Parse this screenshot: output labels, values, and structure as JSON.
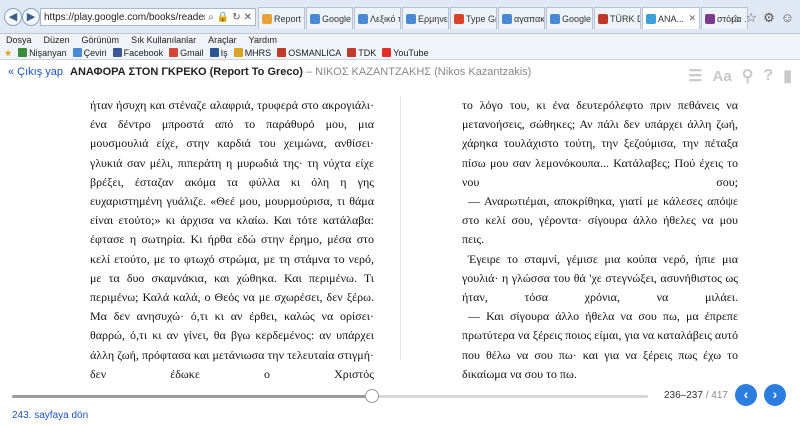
{
  "browser": {
    "url": "https://play.google.com/books/reader?printsec=fr",
    "tabs": [
      {
        "label": "Report t...",
        "color": "#e8a23a"
      },
      {
        "label": "Google ...",
        "color": "#4a8ad4"
      },
      {
        "label": "Λεξικό τ...",
        "color": "#4a8ad4"
      },
      {
        "label": "Ερμηνευ...",
        "color": "#4a8ad4"
      },
      {
        "label": "Type Gr...",
        "color": "#d9442b"
      },
      {
        "label": "αγαπακ...",
        "color": "#4a8ad4"
      },
      {
        "label": "Google ...",
        "color": "#4a8ad4"
      },
      {
        "label": "TÜRK Dİ...",
        "color": "#c0392b"
      },
      {
        "label": "ΑΝΑ...",
        "color": "#3aa0d8",
        "active": true
      },
      {
        "label": "στόμα ...",
        "color": "#7a3b8f"
      }
    ]
  },
  "menu": [
    "Dosya",
    "Düzen",
    "Görünüm",
    "Sık Kullanılanlar",
    "Araçlar",
    "Yardım"
  ],
  "favorites": [
    {
      "label": "Nişanyan",
      "color": "#3c8b3c"
    },
    {
      "label": "Çeviri",
      "color": "#4a8ad4"
    },
    {
      "label": "Facebook",
      "color": "#3b5998"
    },
    {
      "label": "Gmail",
      "color": "#d44638"
    },
    {
      "label": "Iş",
      "color": "#2b5797"
    },
    {
      "label": "MHRS",
      "color": "#d9a520"
    },
    {
      "label": "OSMANLICA",
      "color": "#c0392b"
    },
    {
      "label": "TDK",
      "color": "#c0392b"
    },
    {
      "label": "YouTube",
      "color": "#e52d27"
    }
  ],
  "book": {
    "back_label": "« Çıkış yap",
    "title": "ΑΝΑΦΟΡΑ ΣΤΟΝ ΓΚΡΕΚΟ (Report To Greco)",
    "author": " – ΝΙΚΟΣ ΚΑΖΑΝΤΖΑΚΗΣ (Nikos Kazantzakis)"
  },
  "left_page": [
    "ήταν ήσυχη και στέναζε αλαφριά, τρυφερά στο ακρογιάλι· ένα δέντρο μπροστά από το παράθυρό μου, μια μουσμουλιά είχε, στην καρδιά του χειμώνα, ανθίσει· γλυκιά σαν μέλι, πιπεράτη η μυρωδιά της· τη νύχτα είχε βρέξει, έσταζαν ακόμα τα φύλλα κι όλη η γης ευχαριστημένη γυάλιζε. «Θεέ μου, μουρμούρισα, τι θάμα είναι ετούτο;» κι άρχισα να κλαίω. Και τότε κατάλαβα: έφτασε η σωτηρία. Κι ήρθα εδώ στην έρημο, μέσα στο κελί ετούτο, με το φτωχό στρώμα, με τη στάμνα το νερό, με τα δυο σκαμνάκια, και χώθηκα. Και περιμένω. Τι περιμένω; Καλά καλά, ο Θεός να με σχωρέσει, δεν ξέρω. Μα δεν ανησυχώ· ό,τι κι αν έρθει, καλώς να ορίσει· θαρρώ, ό,τι κι αν γίνει, θα βγω κερδεμένος: αν υπάρχει άλλη ζωή, πρόφτασα και μετάνιωσα την τελευταία στιγμή· δεν έδωκε ο Χριστός"
  ],
  "right_page": [
    "το λόγο του, κι ένα δευτερόλεφτο πριν πεθάνεις να μετανοήσεις, σώθηκες; Αν πάλι δεν υπάρχει άλλη ζωή, χάρηκα τουλάχιστο τούτη, την ξεζούμισα, την πέταξα πίσω μου σαν λεμονόκουπα... Κατάλαβες; Πού έχεις το νου σου;",
    "— Αναρωτιέμαι, αποκρίθηκα, γιατί με κάλεσες απόψε στο κελί σου, γέροντα· σίγουρα άλλο ήθελες να μου πεις.",
    "Έγειρε το σταμνί, γέμισε μια κούπα νερό, ήπιε μια γουλιά· η γλώσσα του θά 'χε στεγνώξει, ασυνήθιστος ως ήταν, τόσα χρόνια, να μιλάει.",
    "— Και σίγουρα άλλο ήθελα να σου πω, μα έπρεπε πρωτύτερα να ξέρεις ποιος είμαι, για να καταλάβεις αυτό που θέλω να σου πω· και για να ξέρεις πως έχω το δικαίωμα να σου το πω."
  ],
  "reader": {
    "pages": "236–237",
    "total": " / 417",
    "progress": 0.566,
    "return_label": "243. sayfaya dön"
  }
}
